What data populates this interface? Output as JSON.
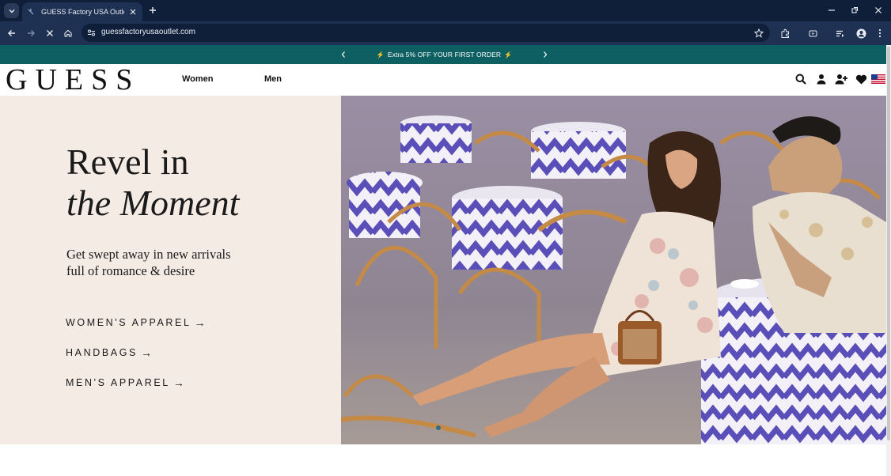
{
  "browser": {
    "tab_title": "GUESS Factory USA Outlet - Gu",
    "url": "guessfactoryusaoutlet.com"
  },
  "promo": {
    "text": "Extra 5% OFF YOUR FIRST ORDER"
  },
  "header": {
    "logo": "GUESS",
    "nav": [
      "Women",
      "Men"
    ]
  },
  "hero": {
    "headline_line1": "Revel in",
    "headline_line2": "the Moment",
    "subhead_line1": "Get swept away in new arrivals",
    "subhead_line2": "full of romance & desire",
    "ctas": [
      "WOMEN'S APPAREL",
      "HANDBAGS",
      "MEN'S APPAREL"
    ],
    "cta_arrow": "→"
  },
  "icons": {
    "header": [
      "search-icon",
      "account-icon",
      "add-user-icon",
      "wishlist-heart-icon",
      "us-flag-icon"
    ]
  },
  "colors": {
    "tabbar": "#0f1f3a",
    "toolbar": "#1f3152",
    "promo_bar": "#0e5f61",
    "hero_left_bg": "#f5ebe5",
    "text_dark": "#1a1a1a"
  }
}
